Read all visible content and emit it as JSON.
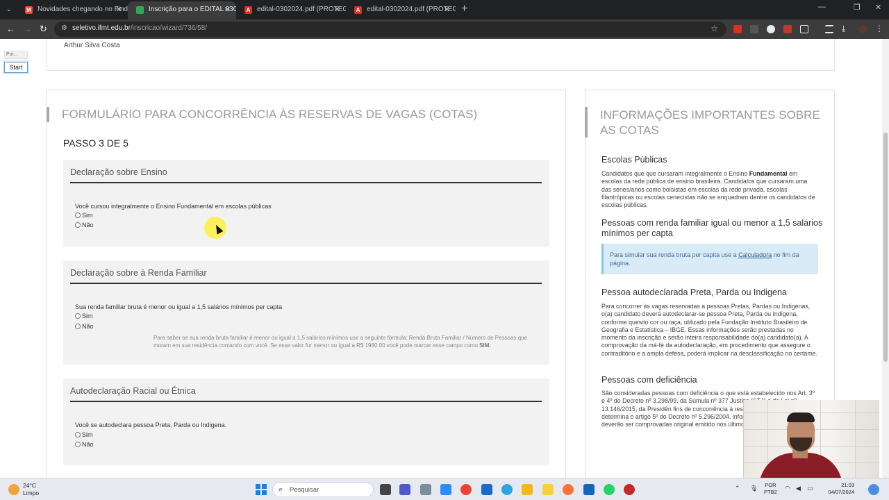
{
  "browser": {
    "tabs": [
      {
        "title": "Novidades chegando no Find Y",
        "icon": "gmail-icon",
        "color": "#ea4335",
        "active": false
      },
      {
        "title": "Inscrição para o EDITAL 030/20",
        "icon": "site-icon",
        "color": "#34a853",
        "active": true
      },
      {
        "title": "edital-0302024.pdf (PROTEGID",
        "icon": "pdf-icon",
        "color": "#d93025",
        "active": false
      },
      {
        "title": "edital-0302024.pdf (PROTEGID",
        "icon": "pdf-icon",
        "color": "#d93025",
        "active": false
      }
    ],
    "url_host": "seletivo.ifmt.edu.br",
    "url_path": "/inscricao/wizard/736/58/"
  },
  "widget": {
    "pill_label": "Poi...",
    "start_label": "Start"
  },
  "top": {
    "name": "Arthur Silva Costa"
  },
  "form": {
    "title": "FORMULÁRIO PARA CONCORRÊNCIA ÀS RESERVAS DE VAGAS (COTAS)",
    "step": "PASSO 3 DE 5",
    "sections": [
      {
        "title": "Declaração sobre Ensino",
        "question": "Você cursou integralmente o Ensino Fundamental em escolas públicas",
        "options": [
          "Sim",
          "Não"
        ]
      },
      {
        "title": "Declaração sobre à Renda Familiar",
        "question": "Sua renda familiar bruta é menor ou igual a 1,5 salários mínimos per capta",
        "options": [
          "Sim",
          "Não"
        ],
        "hint": "Para saber se sua renda bruta familiar é menor ou igual a 1,5 salários mínimos use a seguinte fórmula: Renda Bruta Familiar / Número de Pessoas que moram em sua residência contando com você. Se esse valor for menor ou igual a R$ 1980.00 você pode marcar esse campo como",
        "hint_bold": "SIM."
      },
      {
        "title": "Autodeclaração Racial ou Étnica",
        "question": "Você se autodeclara pessoa Preta, Parda ou Indigena.",
        "options": [
          "Sim",
          "Não"
        ]
      }
    ]
  },
  "info": {
    "title": "INFORMAÇÕES IMPORTANTES SOBRE AS COTAS",
    "publicas_h": "Escolas Públicas",
    "publicas_p1": "Candidatos que que cursaram integralmente o Ensino",
    "publicas_bold": "Fundamental",
    "publicas_p2": "em escolas da rede pública de ensino brasileira. Candidatos que cursaram uma das séries/anos como bolsistas em escolas da rede privada, escolas filantrópicas ou escolas cenecistas não se enquadram dentre os candidatos de escolas públicas.",
    "renda_h": "Pessoas com renda familiar igual ou menor a 1,5 salários mínimos per capta",
    "renda_box_1": "Para simular sua renda bruta per capita use a",
    "renda_box_link": "Calculadora",
    "renda_box_2": "no fim da página.",
    "ppi_h": "Pessoa autodeclarada Preta, Parda ou Indigena",
    "ppi_p": "Para concorrer às vagas reservadas a pessoas Pretas, Pardas ou Indigenas, o(a) candidato deverá autodeclarar-se pessoa Preta, Parda ou Indigena, conforme quesito cor ou raça, utilizado pela Fundação Instituto Brasileiro de Geografia e Estatística – IBGE. Essas informações serão prestadas no momento da inscrição e serão inteira responsabilidade do(a) candidato(a). A comprovação da má-fé da autodeclaração, em procedimento que assegure o contraditório e a ampla defesa, poderá implicar na desclassificação no certame.",
    "pcd_h": "Pessoas com deficiência",
    "pcd_p": "São consideradas pessoas com deficiência o que está estabelecido nos Art. 3º e 4º do Decreto nº 3.298/99, da Súmula nº 377 Justiça (STJ) e da Lei nº 13.146/2015, da Presidên fins de concorrência à reserva de vagas para PcD, determina o artigo 5º do Decreto nº 5.296/2004. informações prestadas deverão ser comprovadas original emitido nos últimos 12 (doze) meses."
  },
  "taskbar": {
    "temp": "24°C",
    "weather": "Limpo",
    "search_placeholder": "Pesquisar",
    "lang_1": "POR",
    "lang_2": "PTB2",
    "time": "21:03",
    "date": "04/07/2024"
  }
}
